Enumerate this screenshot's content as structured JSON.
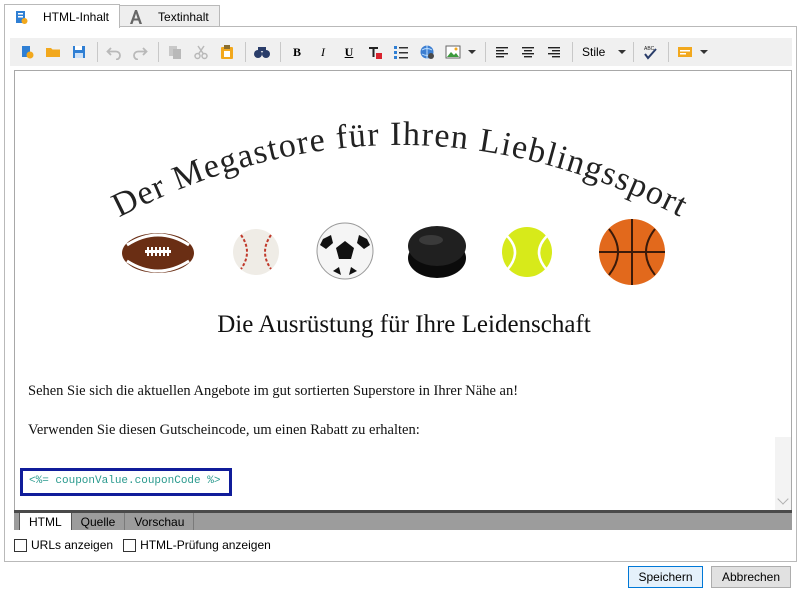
{
  "tabs": [
    {
      "label": "HTML-Inhalt",
      "icon": "html-content-icon"
    },
    {
      "label": "Textinhalt",
      "icon": "text-content-icon"
    }
  ],
  "toolbar": {
    "icons": [
      "new-icon",
      "open-folder-icon",
      "save-icon",
      "undo-icon",
      "redo-icon",
      "copy-icon",
      "cut-icon",
      "paste-icon",
      "find-icon",
      "bold-icon",
      "italic-icon",
      "underline-icon",
      "text-color-icon",
      "bullet-list-icon",
      "link-icon",
      "image-icon",
      "align-left-icon",
      "align-center-icon",
      "align-right-icon",
      "spellcheck-icon",
      "personalization-icon"
    ],
    "bold": "B",
    "italic": "I",
    "underline": "U",
    "styles_label": "Stile"
  },
  "content": {
    "headline": "Der Megastore für Ihren Lieblingssport",
    "subtitle": "Die Ausrüstung für Ihre Leidenschaft",
    "paragraph1": "Sehen Sie sich die aktuellen Angebote im gut sortierten Superstore in Ihrer Nähe an!",
    "paragraph2": "Verwenden Sie diesen Gutscheincode, um einen Rabatt zu erhalten:",
    "coupon_code": "<%= couponValue.couponCode %>",
    "balls": [
      "football",
      "baseball",
      "soccer-ball",
      "hockey-puck",
      "tennis-ball",
      "basketball"
    ]
  },
  "mode_tabs": [
    "HTML",
    "Quelle",
    "Vorschau"
  ],
  "checkboxes": [
    {
      "label": "URLs anzeigen",
      "checked": false
    },
    {
      "label": "HTML-Prüfung anzeigen",
      "checked": false
    }
  ],
  "buttons": {
    "save": "Speichern",
    "cancel": "Abbrechen"
  },
  "colors": {
    "coupon_border": "#101c9a",
    "coupon_text": "#2a9a8e",
    "primary_button_border": "#0078d7"
  }
}
